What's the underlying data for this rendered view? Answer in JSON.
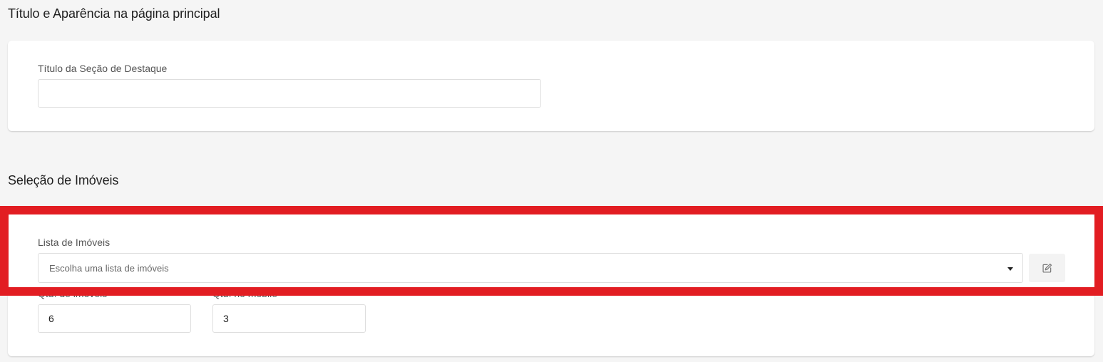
{
  "sections": {
    "appearance": {
      "title": "Título e Aparência na página principal",
      "featured_title_label": "Título da Seção de Destaque",
      "featured_title_value": ""
    },
    "selection": {
      "title": "Seleção de Imóveis",
      "list_label": "Lista de Imóveis",
      "list_placeholder": "Escolha uma lista de imóveis",
      "qty_label": "Qtd. de imóveis",
      "qty_value": "6",
      "qty_mobile_label": "Qtd. no mobile",
      "qty_mobile_value": "3"
    }
  },
  "icons": {
    "caret": "caret-down-icon",
    "edit": "edit-icon"
  },
  "colors": {
    "highlight": "#e21d22",
    "background": "#f5f5f5",
    "card": "#ffffff"
  }
}
